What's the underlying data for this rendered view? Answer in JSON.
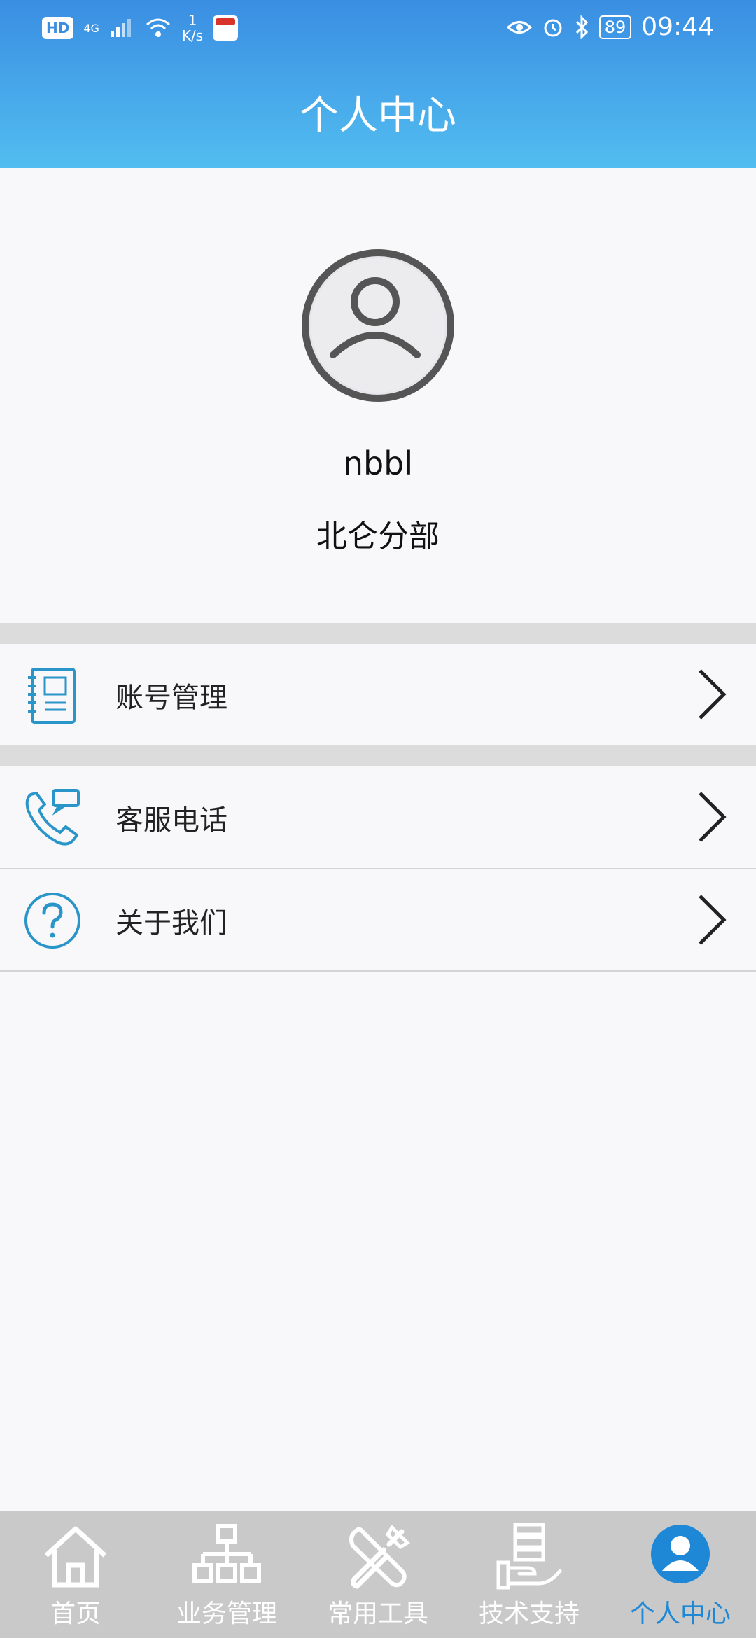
{
  "status_bar": {
    "hd": "HD",
    "network": "4G",
    "speed_value": "1",
    "speed_unit": "K/s",
    "battery": "89",
    "time": "09:44"
  },
  "header": {
    "title": "个人中心"
  },
  "profile": {
    "username": "nbbl",
    "department": "北仑分部"
  },
  "menu": {
    "items": [
      {
        "label": "账号管理",
        "icon": "notebook-icon"
      },
      {
        "label": "客服电话",
        "icon": "phone-chat-icon"
      },
      {
        "label": "关于我们",
        "icon": "question-icon"
      }
    ]
  },
  "tabbar": {
    "active_color": "#1e88d6",
    "items": [
      {
        "label": "首页",
        "icon": "home-icon"
      },
      {
        "label": "业务管理",
        "icon": "org-chart-icon"
      },
      {
        "label": "常用工具",
        "icon": "tools-icon"
      },
      {
        "label": "技术支持",
        "icon": "server-hand-icon"
      },
      {
        "label": "个人中心",
        "icon": "user-circle-icon",
        "active": true
      }
    ]
  }
}
